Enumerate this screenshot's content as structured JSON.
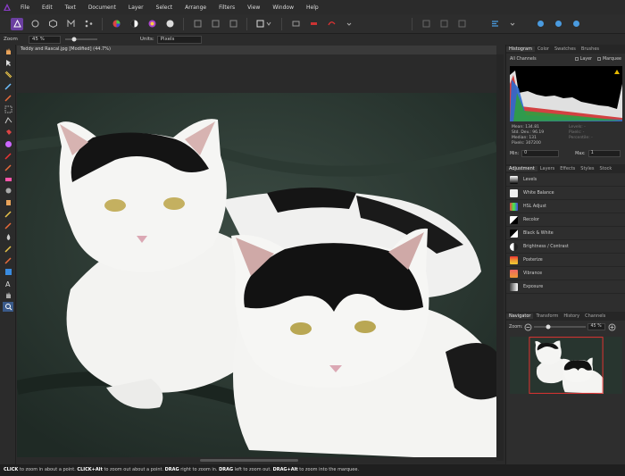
{
  "menu": [
    "File",
    "Edit",
    "Text",
    "Document",
    "Layer",
    "Select",
    "Arrange",
    "Filters",
    "View",
    "Window",
    "Help"
  ],
  "context": {
    "zoom_label": "Zoom",
    "zoom_value": "45 %",
    "units_label": "Units:",
    "units_value": "Pixels"
  },
  "document": {
    "tab_title": "Teddy and Rascal.jpg [Modified] (44.7%)"
  },
  "histogram": {
    "tabs": [
      "Histogram",
      "Color",
      "Swatches",
      "Brushes"
    ],
    "channel": "All Channels",
    "layer_label": "Layer",
    "marquee_label": "Marquee",
    "stats_left": [
      "Mean: 134.81",
      "Std. Dev.: 96.19",
      "Median: 131",
      "Pixels: 307200"
    ],
    "stats_right": [
      "Levels: -",
      "Pixels: -",
      "Percentile: -"
    ],
    "min_label": "Min:",
    "min_value": "0",
    "max_label": "Max:",
    "max_value": "1"
  },
  "adjust": {
    "tabs": [
      "Adjustment",
      "Layers",
      "Effects",
      "Styles",
      "Stock"
    ],
    "items": [
      "Levels",
      "White Balance",
      "HSL Adjust",
      "Recolor",
      "Black & White",
      "Brightness / Contrast",
      "Posterize",
      "Vibrance",
      "Exposure"
    ]
  },
  "navigator": {
    "tabs": [
      "Navigator",
      "Transform",
      "History",
      "Channels"
    ],
    "zoom_label": "Zoom:",
    "zoom_value": "45 %"
  },
  "status": {
    "t1": "CLICK",
    "t2": " to zoom in about a point. ",
    "t3": "CLICK+Alt",
    "t4": " to zoom out about a point. ",
    "t5": "DRAG",
    "t6": " right to zoom in. ",
    "t7": "DRAG",
    "t8": " left to zoom out. ",
    "t9": "DRAG+Alt",
    "t10": " to zoom into the marquee."
  }
}
